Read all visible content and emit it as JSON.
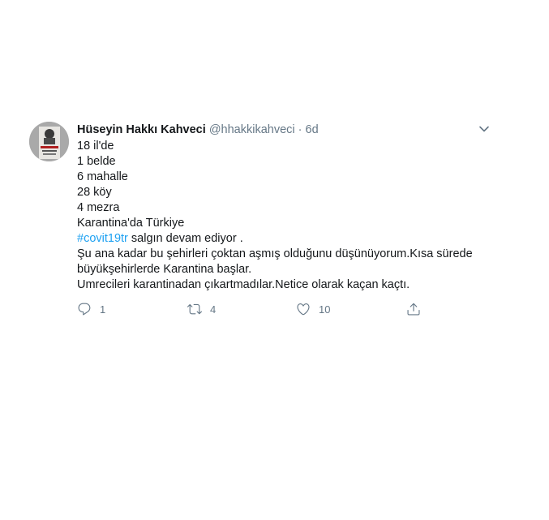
{
  "author": {
    "name": "Hüseyin Hakkı Kahveci",
    "handle": "@hhakkikahveci",
    "separator": "·",
    "time": "6d"
  },
  "tweet": {
    "lines": [
      "18 il'de",
      "1 belde",
      "6 mahalle",
      "28 köy",
      "4 mezra",
      "Karantina'da Türkiye"
    ],
    "hashtag": "#covit19tr",
    "hashtag_rest": " salgın devam ediyor .",
    "line_a": "Şu ana kadar bu şehirleri çoktan aşmış olduğunu düşünüyorum.Kısa sürede",
    "line_b": "büyükşehirlerde Karantina başlar.",
    "line_c": "Umrecileri karantinadan çıkartmadılar.Netice olarak kaçan kaçtı."
  },
  "actions": {
    "reply_count": "1",
    "retweet_count": "4",
    "like_count": "10"
  },
  "icons": {
    "caret": "chevron-down-icon",
    "reply": "reply-icon",
    "retweet": "retweet-icon",
    "like": "heart-icon",
    "share": "share-icon"
  },
  "colors": {
    "text": "#14171a",
    "muted": "#657786",
    "link": "#1da1f2"
  }
}
